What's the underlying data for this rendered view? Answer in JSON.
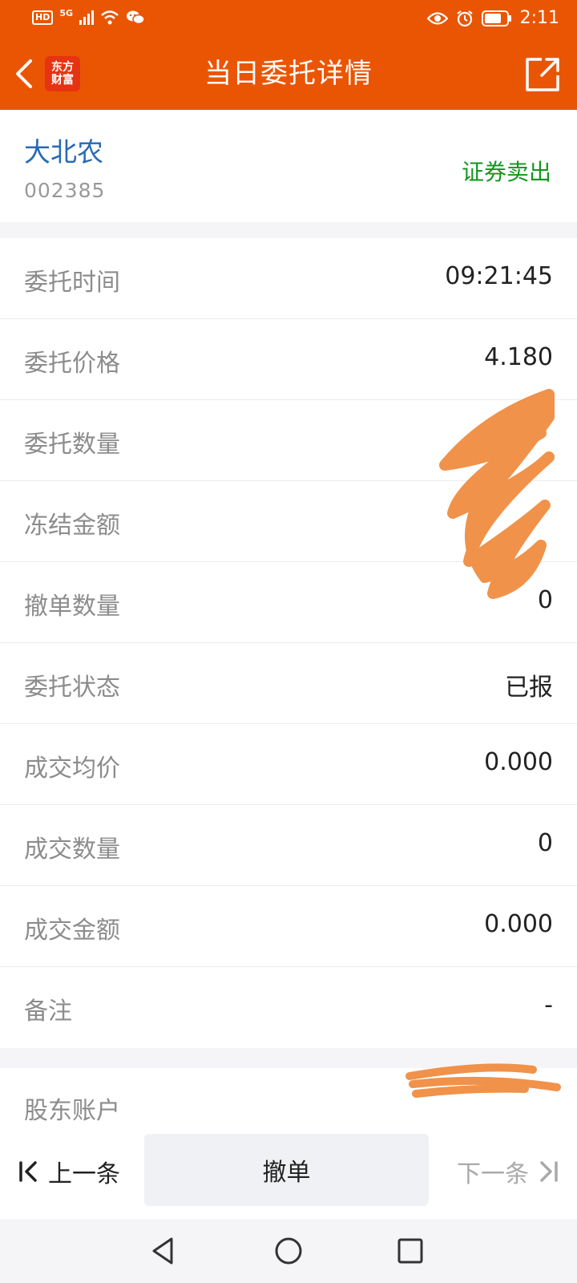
{
  "status_bar": {
    "hd_label": "HD",
    "network": "5G",
    "time": "2:11",
    "icons": [
      "signal-icon",
      "wifi-icon",
      "wechat-icon",
      "eye-icon",
      "alarm-icon",
      "battery-icon"
    ]
  },
  "header": {
    "title": "当日委托详情",
    "logo_line1": "东方",
    "logo_line2": "财富",
    "accent_color": "#ea5504"
  },
  "stock": {
    "name": "大北农",
    "code": "002385",
    "trade_type": "证券卖出"
  },
  "details": [
    {
      "label": "委托时间",
      "value": "09:21:45"
    },
    {
      "label": "委托价格",
      "value": "4.180"
    },
    {
      "label": "委托数量",
      "value": ""
    },
    {
      "label": "冻结金额",
      "value": ""
    },
    {
      "label": "撤单数量",
      "value": "0"
    },
    {
      "label": "委托状态",
      "value": "已报"
    },
    {
      "label": "成交均价",
      "value": "0.000"
    },
    {
      "label": "成交数量",
      "value": "0"
    },
    {
      "label": "成交金额",
      "value": "0.000"
    },
    {
      "label": "备注",
      "value": "-"
    }
  ],
  "shareholder": {
    "label": "股东账户",
    "value": ""
  },
  "actions": {
    "prev_label": "上一条",
    "cancel_label": "撤单",
    "next_label": "下一条"
  }
}
